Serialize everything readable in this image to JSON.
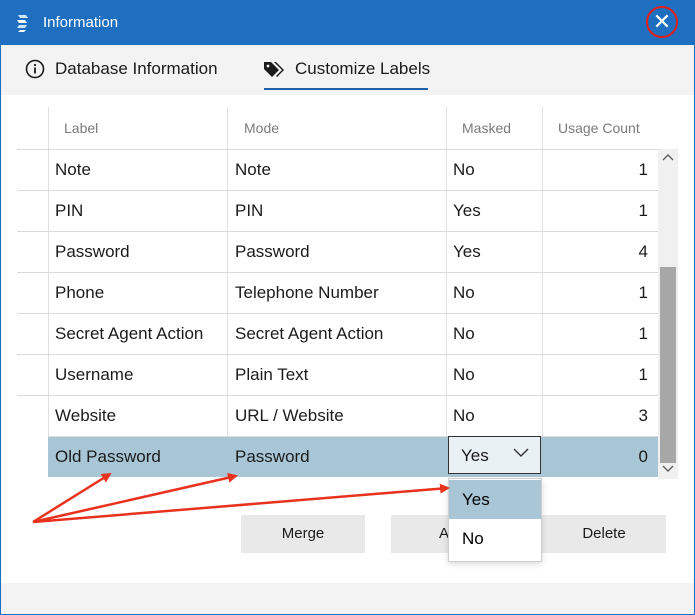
{
  "window": {
    "title": "Information"
  },
  "tabs": [
    {
      "label": "Database Information",
      "icon": "info-icon",
      "active": false
    },
    {
      "label": "Customize Labels",
      "icon": "tag-icon",
      "active": true
    }
  ],
  "table": {
    "columns": [
      "Label",
      "Mode",
      "Masked",
      "Usage Count"
    ],
    "rows": [
      {
        "label": "Note",
        "mode": "Note",
        "masked": "No",
        "count": "1"
      },
      {
        "label": "PIN",
        "mode": "PIN",
        "masked": "Yes",
        "count": "1"
      },
      {
        "label": "Password",
        "mode": "Password",
        "masked": "Yes",
        "count": "4"
      },
      {
        "label": "Phone",
        "mode": "Telephone Number",
        "masked": "No",
        "count": "1"
      },
      {
        "label": "Secret Agent Action",
        "mode": "Secret Agent Action",
        "masked": "No",
        "count": "1"
      },
      {
        "label": "Username",
        "mode": "Plain Text",
        "masked": "No",
        "count": "1"
      },
      {
        "label": "Website",
        "mode": "URL / Website",
        "masked": "No",
        "count": "3"
      },
      {
        "label": "Old Password",
        "mode": "Password",
        "masked": "Yes",
        "count": "0"
      }
    ]
  },
  "dropdown": {
    "current": "Yes",
    "options": [
      "Yes",
      "No"
    ]
  },
  "buttons": {
    "merge": "Merge",
    "add": "A",
    "delete": "Delete"
  },
  "colors": {
    "titlebar": "#1e6fbf",
    "selection": "#a8c6d6",
    "annotation": "#e8321e"
  }
}
